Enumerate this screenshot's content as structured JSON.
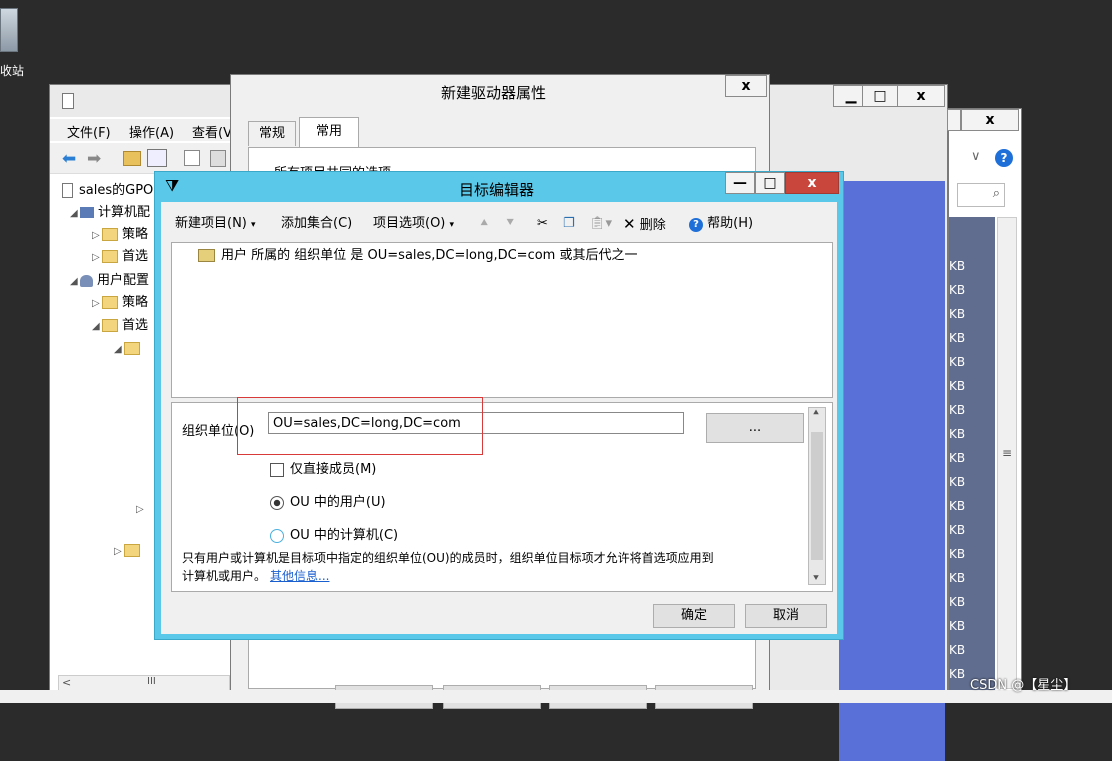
{
  "desktop": {
    "recycle_label": "收站"
  },
  "gpo_window": {
    "menu": [
      "文件(F)",
      "操作(A)",
      "查看(V"
    ],
    "tree": [
      {
        "label": "sales的GPO"
      },
      {
        "label": "计算机配"
      },
      {
        "label": "策略"
      },
      {
        "label": "首选"
      },
      {
        "label": "用户配置"
      },
      {
        "label": "策略"
      },
      {
        "label": "首选"
      }
    ],
    "scroll_thumb": "III"
  },
  "back_window": {
    "close": "x",
    "minimize": "▁",
    "maximize": "□",
    "sizes": [
      "KB",
      "KB",
      "KB",
      "KB",
      "KB",
      "KB",
      "KB",
      "KB",
      "KB",
      "KB",
      "KB",
      "KB",
      "KB",
      "KB",
      "KB",
      "KB",
      "KB",
      "KB"
    ],
    "scroll_grip": "≡"
  },
  "drive_dialog": {
    "title": "新建驱动器属性",
    "close": "x",
    "tabs": [
      "常规",
      "常用"
    ],
    "section_text": "所有项目共同的选项"
  },
  "target_editor": {
    "title": "目标编辑器",
    "minimize": "—",
    "maximize": "□",
    "close": "x",
    "toolbar": {
      "new_item": "新建项目(N)",
      "add_collection": "添加集合(C)",
      "item_options": "项目选项(O)",
      "delete": "删除",
      "help": "帮助(H)"
    },
    "targeting_item": "用户 所属的 组织单位 是 OU=sales,DC=long,DC=com 或其后代之一",
    "ou_label": "组织单位(O)",
    "ou_value": "OU=sales,DC=long,DC=com",
    "browse_label": "...",
    "direct_member_label": "仅直接成员(M)",
    "users_in_ou_label": "OU 中的用户(U)",
    "computers_in_ou_label": "OU 中的计算机(C)",
    "help_text_1": "只有用户或计算机是目标项中指定的组织单位(OU)的成员时，组织单位目标项才允许将首选项应用到",
    "help_text_2": "计算机或用户。",
    "more_info": "其他信息...",
    "ok": "确定",
    "cancel": "取消"
  },
  "watermark": "CSDN @【星尘】"
}
